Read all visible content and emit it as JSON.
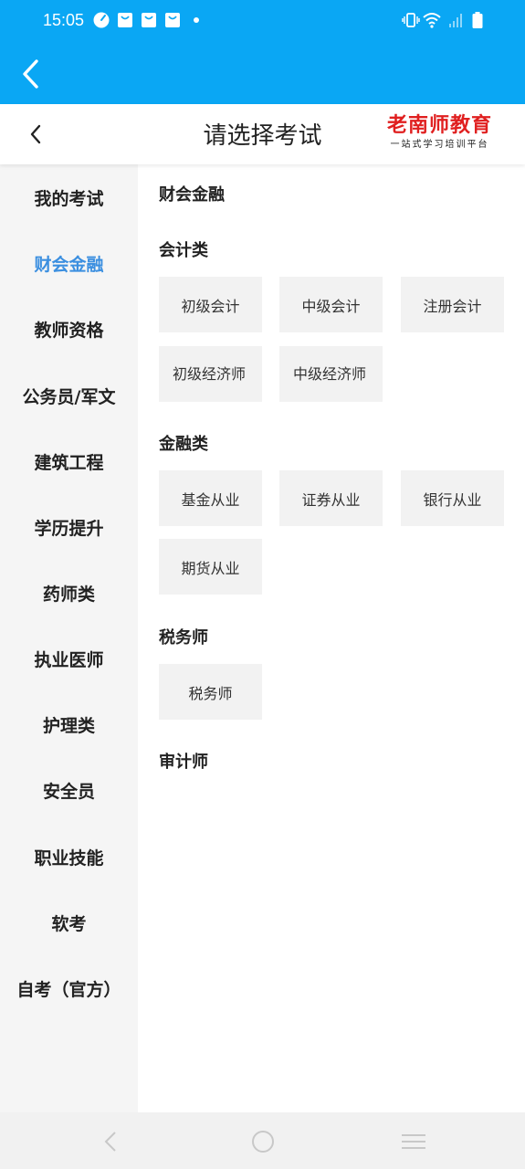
{
  "status_bar": {
    "time": "15:05",
    "icons": [
      "speed-icon",
      "bag-icon",
      "bag-icon",
      "bag-icon",
      "dot-icon",
      "vibrate-icon",
      "wifi-icon",
      "signal-icon",
      "battery-icon"
    ]
  },
  "app_bar": {
    "back_icon": "arrow-left-icon",
    "color": "#0aa7f4"
  },
  "header": {
    "title": "请选择考试",
    "brand_name": "老南师教育",
    "brand_slogan": "一站式学习培训平台",
    "brand_color": "#e02020"
  },
  "sidebar": {
    "active_color": "#3b8fe0",
    "items": [
      {
        "label": "我的考试"
      },
      {
        "label": "财会金融",
        "active": true
      },
      {
        "label": "教师资格"
      },
      {
        "label": "公务员/军文"
      },
      {
        "label": "建筑工程"
      },
      {
        "label": "学历提升"
      },
      {
        "label": "药师类"
      },
      {
        "label": "执业医师"
      },
      {
        "label": "护理类"
      },
      {
        "label": "安全员"
      },
      {
        "label": "职业技能"
      },
      {
        "label": "软考"
      },
      {
        "label": "自考（官方）"
      }
    ]
  },
  "content": {
    "heading": "财会金融",
    "sections": [
      {
        "title": "会计类",
        "chips": [
          "初级会计",
          "中级会计",
          "注册会计",
          "初级经济师",
          "中级经济师"
        ]
      },
      {
        "title": "金融类",
        "chips": [
          "基金从业",
          "证券从业",
          "银行从业",
          "期货从业"
        ]
      },
      {
        "title": "税务师",
        "chips": [
          "税务师"
        ]
      },
      {
        "title": "审计师",
        "chips": []
      }
    ]
  },
  "nav_bar": {
    "icons": [
      "back-nav-icon",
      "home-nav-icon",
      "menu-nav-icon"
    ]
  }
}
